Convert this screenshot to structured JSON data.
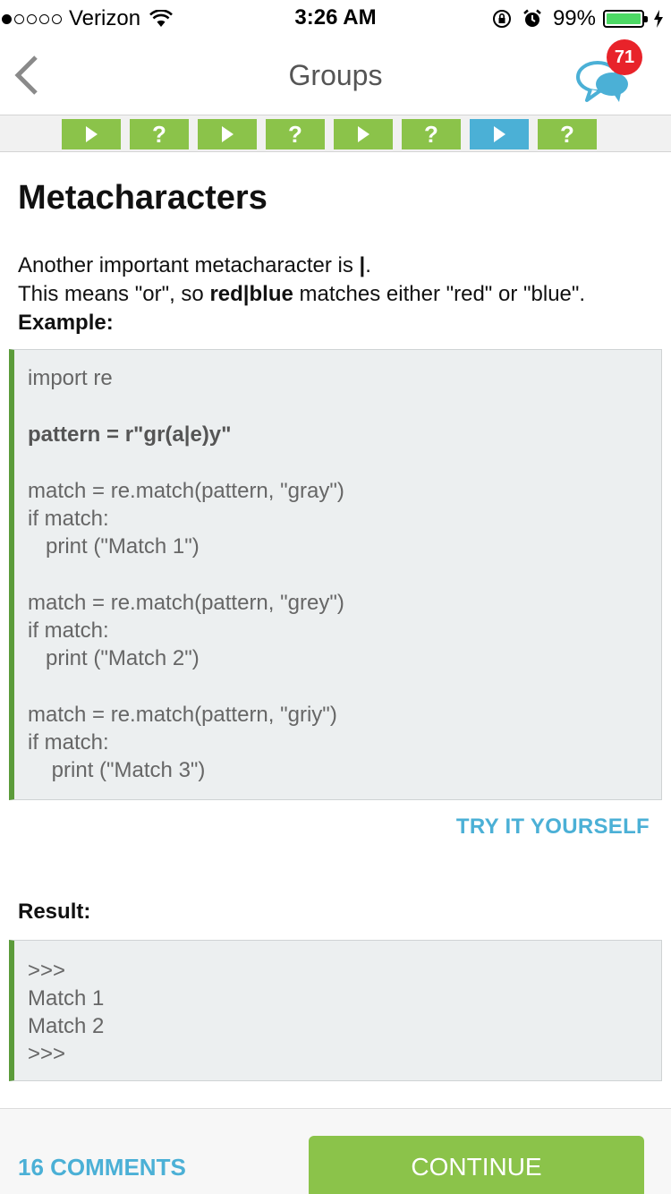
{
  "status_bar": {
    "carrier": "Verizon",
    "time": "3:26 AM",
    "battery_percent": "99%",
    "battery_level": 0.99,
    "signal_bars_filled": 1,
    "signal_bars_total": 5,
    "icons": [
      "wifi-icon",
      "orientation-lock-icon",
      "alarm-icon",
      "battery-icon",
      "charging-icon"
    ]
  },
  "nav": {
    "title": "Groups",
    "back_icon": "chevron-left-icon",
    "chat_icon": "chat-bubbles-icon",
    "badge_count": "71"
  },
  "progress": {
    "steps": [
      {
        "type": "play",
        "label": "",
        "current": false
      },
      {
        "type": "quiz",
        "label": "?",
        "current": false
      },
      {
        "type": "play",
        "label": "",
        "current": false
      },
      {
        "type": "quiz",
        "label": "?",
        "current": false
      },
      {
        "type": "play",
        "label": "",
        "current": false
      },
      {
        "type": "quiz",
        "label": "?",
        "current": false
      },
      {
        "type": "play",
        "label": "",
        "current": true
      },
      {
        "type": "quiz",
        "label": "?",
        "current": false
      }
    ]
  },
  "lesson": {
    "title": "Metacharacters",
    "intro_line1_a": "Another important metacharacter is ",
    "intro_line1_b": "|",
    "intro_line1_c": ".",
    "intro_line2_a": "This means \"or\", so ",
    "intro_line2_b": "red|blue",
    "intro_line2_c": " matches either \"red\" or \"blue\".",
    "example_label": "Example:"
  },
  "example_code": [
    "import re",
    "pattern = r\"gr(a|e)y\"",
    "match = re.match(pattern, \"gray\")",
    "if match:",
    "   print (\"Match 1\")",
    "match = re.match(pattern, \"grey\")",
    "if match:",
    "   print (\"Match 2\")",
    "match = re.match(pattern, \"griy\")",
    "if match:",
    "    print (\"Match 3\")"
  ],
  "try_label": "TRY IT YOURSELF",
  "result_label": "Result:",
  "result_output": [
    ">>>",
    "Match 1",
    "Match 2",
    ">>>"
  ],
  "bottom": {
    "comments_label": "16 COMMENTS",
    "continue_label": "CONTINUE"
  },
  "colors": {
    "green": "#8bc34a",
    "blue": "#4bb0d6",
    "badge_red": "#e8232a",
    "code_border": "#5b9b3a"
  }
}
